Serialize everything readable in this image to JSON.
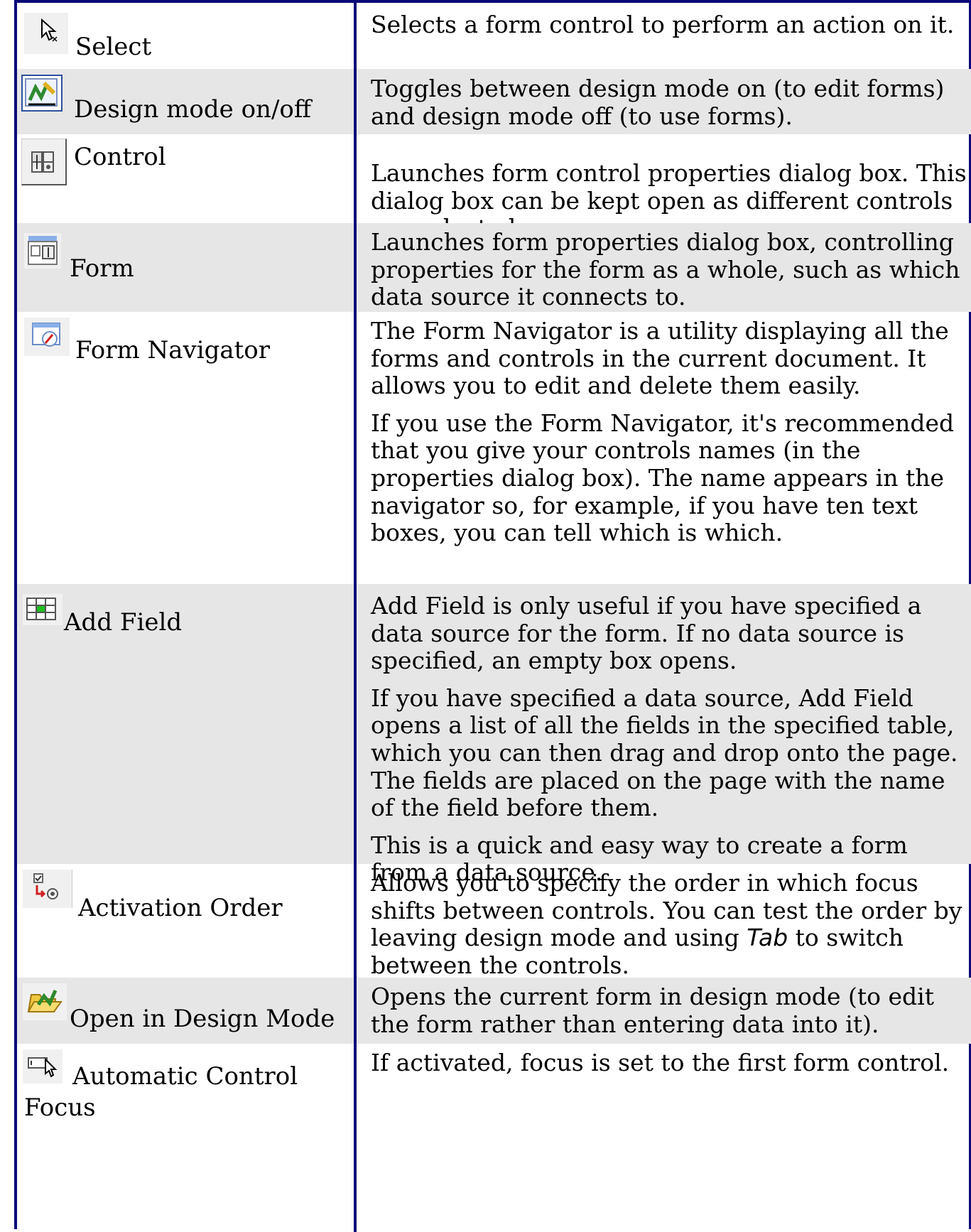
{
  "rows": [
    {
      "icon": "select-arrow-icon",
      "label": "Select",
      "paragraphs": [
        "Selects a form control to perform an action on it."
      ]
    },
    {
      "icon": "design-mode-icon",
      "label": "Design mode on/off",
      "paragraphs": [
        "Toggles between design mode on (to edit forms) and design mode off (to use forms)."
      ]
    },
    {
      "icon": "control-properties-icon",
      "label": "Control",
      "paragraphs": [
        "Launches form control properties dialog box. This dialog box can be kept open as different controls are selected."
      ]
    },
    {
      "icon": "form-properties-icon",
      "label": "Form",
      "paragraphs": [
        "Launches form properties dialog box, controlling properties for the form as a whole, such as which data source it connects to."
      ]
    },
    {
      "icon": "form-navigator-icon",
      "label": "Form Navigator",
      "paragraphs": [
        "The Form Navigator is a utility displaying all the forms and controls in the current document.  It allows you to edit and delete them easily.",
        "If you use the Form Navigator, it's recommended that you give your controls names (in the properties dialog box). The name appears in the navigator so, for example, if you have ten text boxes, you can tell which is which."
      ]
    },
    {
      "icon": "add-field-icon",
      "label": "Add Field",
      "paragraphs": [
        "Add Field is only useful if you have specified a data source for the form. If no data source is specified, an empty box opens.",
        "If you have specified a data source, Add Field opens a list of all the fields in the specified table, which you can then drag and drop onto the page. The fields are placed on the page with the name of the field before them.",
        "This is a quick and easy way to create a form from a data source."
      ]
    },
    {
      "icon": "activation-order-icon",
      "label": "Activation Order",
      "para_parts": {
        "before": "Allows you to specify the order in which focus shifts between controls. You can test the order by leaving design mode and using ",
        "italic": "Tab",
        "after": " to switch between the controls."
      }
    },
    {
      "icon": "open-design-mode-icon",
      "label": "Open in Design Mode",
      "paragraphs": [
        "Opens the current form in design mode (to edit the form rather than entering data into it)."
      ]
    },
    {
      "icon": "automatic-control-focus-icon",
      "label_line1": "Automatic Control",
      "label_line2": "Focus",
      "paragraphs": [
        "If activated, focus is set to the first form control."
      ]
    }
  ]
}
